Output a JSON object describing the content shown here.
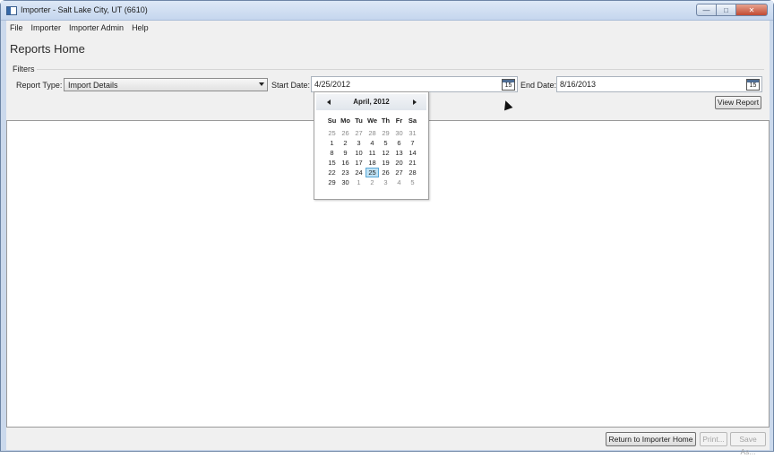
{
  "window": {
    "title": "Importer - Salt Lake City, UT (6610)"
  },
  "menu": [
    "File",
    "Importer",
    "Importer Admin",
    "Help"
  ],
  "page_title": "Reports Home",
  "filters": {
    "label": "Filters",
    "report_type_label": "Report Type:",
    "report_type_value": "Import Details",
    "start_date_label": "Start Date:",
    "start_date_value": "4/25/2012",
    "end_date_label": "End Date:",
    "end_date_value": "8/16/2013",
    "calendar_icon_text": "15",
    "view_report_label": "View Report"
  },
  "calendar": {
    "month_title": "April, 2012",
    "days_of_week": [
      "Su",
      "Mo",
      "Tu",
      "We",
      "Th",
      "Fr",
      "Sa"
    ],
    "weeks": [
      [
        "25",
        "26",
        "27",
        "28",
        "29",
        "30",
        "31"
      ],
      [
        "1",
        "2",
        "3",
        "4",
        "5",
        "6",
        "7"
      ],
      [
        "8",
        "9",
        "10",
        "11",
        "12",
        "13",
        "14"
      ],
      [
        "15",
        "16",
        "17",
        "18",
        "19",
        "20",
        "21"
      ],
      [
        "22",
        "23",
        "24",
        "25",
        "26",
        "27",
        "28"
      ],
      [
        "29",
        "30",
        "1",
        "2",
        "3",
        "4",
        "5"
      ]
    ],
    "selected_day": "25"
  },
  "bottom_buttons": {
    "return_label": "Return to Importer Home",
    "print_label": "Print...",
    "save_as_label": "Save As..."
  }
}
